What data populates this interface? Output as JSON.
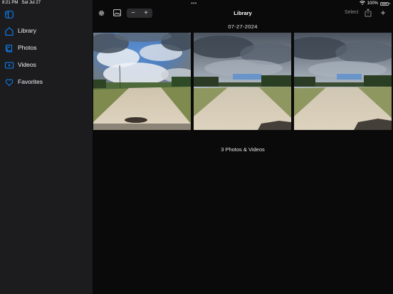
{
  "status_bar": {
    "time": "8:21 PM",
    "date": "Sat Jul 27",
    "battery": "100%"
  },
  "sidebar": {
    "items": [
      {
        "label": "Library",
        "icon": "library-icon"
      },
      {
        "label": "Photos",
        "icon": "photos-icon"
      },
      {
        "label": "Videos",
        "icon": "videos-icon"
      },
      {
        "label": "Favorites",
        "icon": "heart-icon"
      }
    ]
  },
  "toolbar": {
    "title": "Library",
    "zoom_out": "−",
    "zoom_in": "+",
    "select_label": "Select",
    "add_label": "+"
  },
  "main": {
    "date_header": "07-27-2024",
    "item_count": "3 Photos & Videos"
  },
  "colors": {
    "accent": "#0a84ff",
    "sidebar_bg": "#1c1c1e",
    "main_bg": "#0a0a0a"
  }
}
